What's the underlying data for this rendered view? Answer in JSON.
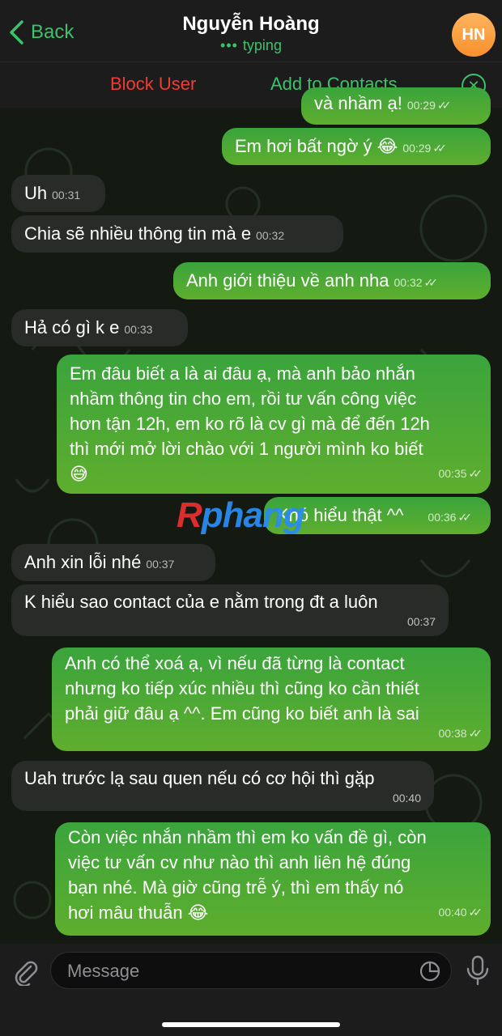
{
  "header": {
    "back_label": "Back",
    "contact_name": "Nguyễn Hoàng",
    "status": "typing",
    "avatar_initials": "HN"
  },
  "actions": {
    "block_label": "Block User",
    "add_label": "Add to Contacts"
  },
  "messages": [
    {
      "dir": "out",
      "text": "và nhầm ạ!",
      "time": "00:29"
    },
    {
      "dir": "out",
      "text": "Em hơi bất ngờ ý 😂",
      "time": "00:29"
    },
    {
      "dir": "in",
      "text": "Uh",
      "time": "00:31"
    },
    {
      "dir": "in",
      "text": "Chia sẽ nhiều thông tin mà e",
      "time": "00:32"
    },
    {
      "dir": "out",
      "text": "Anh giới thiệu về anh nha",
      "time": "00:32"
    },
    {
      "dir": "in",
      "text": "Hả có gì k e",
      "time": "00:33"
    },
    {
      "dir": "out",
      "lines": [
        "Em đâu biết a là ai đâu ạ, mà anh bảo nhắn",
        "nhầm thông tin cho em, rồi tư vấn công việc",
        "hơn tận 12h, em ko rõ là cv gì mà để đến 12h",
        "thì mới mở lời chào với 1 người mình ko biết",
        "😅"
      ],
      "time": "00:35"
    },
    {
      "dir": "out",
      "text": "Khó hiểu thật ^^",
      "time": "00:36"
    },
    {
      "dir": "in",
      "text": "Anh xin lỗi nhé",
      "time": "00:37"
    },
    {
      "dir": "in",
      "lines": [
        "K hiểu sao contact của e nằm trong đt a luôn"
      ],
      "time": "00:37"
    },
    {
      "dir": "out",
      "lines": [
        "Anh có thể xoá ạ, vì nếu đã từng là contact",
        "nhưng ko tiếp xúc nhiều thì cũng ko cần thiết",
        "phải giữ đâu ạ ^^. Em cũng ko biết anh là sai"
      ],
      "time": "00:38"
    },
    {
      "dir": "in",
      "lines": [
        "Uah trước lạ sau quen nếu có cơ hội thì gặp"
      ],
      "time": "00:40"
    },
    {
      "dir": "out",
      "lines": [
        "Còn việc nhắn nhầm thì em ko vấn đề gì, còn",
        "việc tư vấn cv như nào thì anh liên hệ đúng",
        "bạn nhé. Mà giờ cũng trễ ý, thì em thấy nó",
        "hơi mâu thuẫn 😂"
      ],
      "time": "00:40"
    }
  ],
  "watermark": {
    "part1": "R",
    "part2": "phang"
  },
  "composer": {
    "placeholder": "Message"
  },
  "icons": {
    "back": "chevron-left-icon",
    "close": "close-circle-icon",
    "attach": "paperclip-icon",
    "sticker": "sticker-icon",
    "mic": "microphone-icon"
  },
  "colors": {
    "accent": "#3ec16b",
    "danger": "#f23b32",
    "outgoing": "#4aa83a",
    "incoming": "#282b27"
  }
}
